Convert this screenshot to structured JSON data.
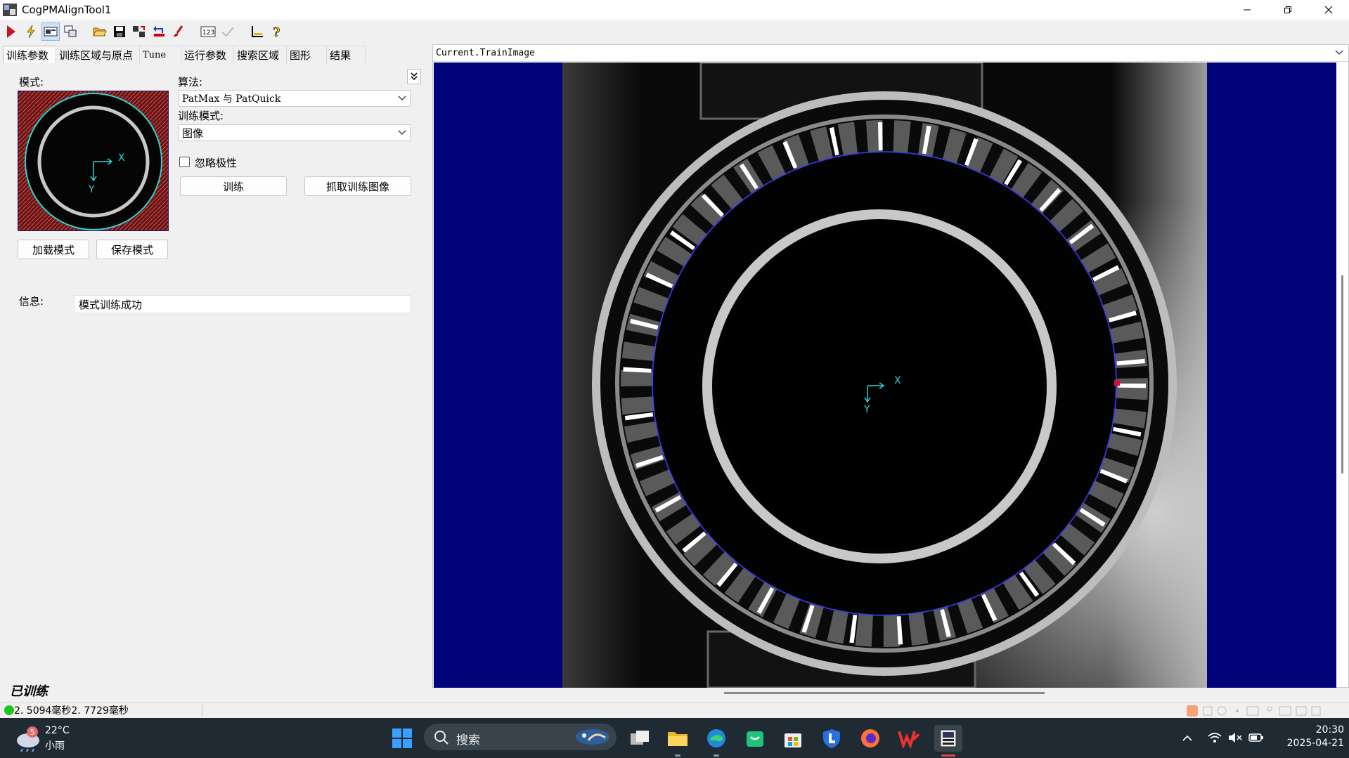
{
  "window": {
    "title": "CogPMAlignTool1"
  },
  "tabs": [
    {
      "label": "训练参数",
      "active": true
    },
    {
      "label": "训练区域与原点",
      "active": false
    },
    {
      "label": "Tune",
      "active": false
    },
    {
      "label": "运行参数",
      "active": false
    },
    {
      "label": "搜索区域",
      "active": false
    },
    {
      "label": "图形",
      "active": false
    },
    {
      "label": "结果",
      "active": false
    }
  ],
  "left": {
    "pattern_label": "模式:",
    "load_pattern": "加载模式",
    "save_pattern": "保存模式",
    "algorithm_label": "算法:",
    "algorithm_value": "PatMax 与 PatQuick",
    "train_mode_label": "训练模式:",
    "train_mode_value": "图像",
    "ignore_polarity_label": "忽略极性",
    "ignore_polarity_checked": false,
    "train_button": "训练",
    "grab_train_image_button": "抓取训练图像",
    "info_label": "信息:",
    "info_value": "模式训练成功",
    "trained_status": "已训练"
  },
  "status": {
    "timing": "2. 5094毫秒2. 7729毫秒"
  },
  "display": {
    "header": "Current.TrainImage",
    "axis_x": "X",
    "axis_y": "Y"
  },
  "taskbar": {
    "weather_temp": "22°C",
    "weather_cond": "小雨",
    "weather_badge": "5",
    "search_placeholder": "搜索",
    "time": "20:30",
    "date": "2025-04-21"
  },
  "colors": {
    "canvas_bg": "#000478",
    "pattern_outline": "#2ad4d4",
    "overlay_circle": "#3a3aff",
    "taskbar_bg": "#1f2a33"
  }
}
